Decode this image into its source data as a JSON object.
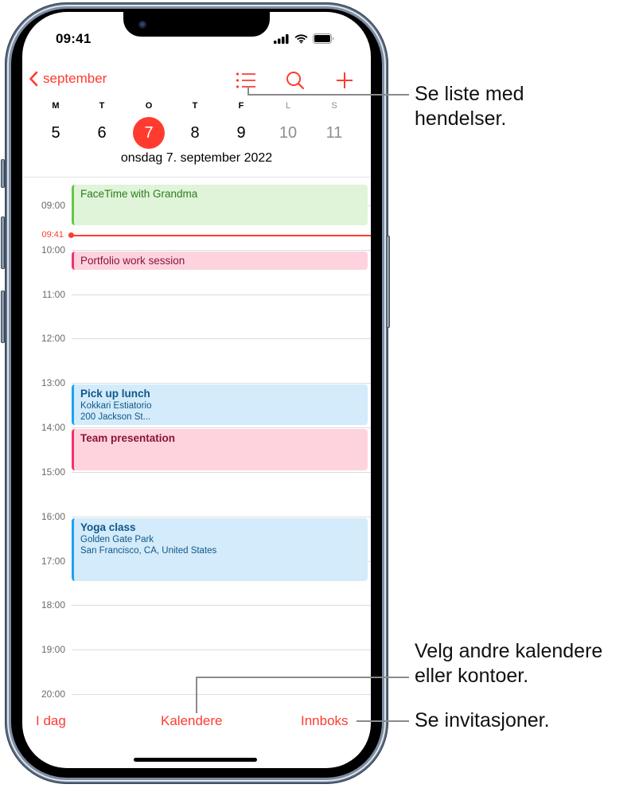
{
  "status_bar": {
    "time": "09:41",
    "icons": [
      "cellular-signal-icon",
      "wifi-icon",
      "battery-icon"
    ]
  },
  "nav": {
    "back_label": "september",
    "back_icon": "chevron-left-icon",
    "actions": [
      {
        "name": "list-view-button",
        "icon": "list-icon"
      },
      {
        "name": "search-button",
        "icon": "search-icon"
      },
      {
        "name": "add-event-button",
        "icon": "plus-icon"
      }
    ]
  },
  "week": {
    "days": [
      {
        "letter": "M",
        "number": "5",
        "selected": false,
        "weekend": false
      },
      {
        "letter": "T",
        "number": "6",
        "selected": false,
        "weekend": false
      },
      {
        "letter": "O",
        "number": "7",
        "selected": true,
        "weekend": false
      },
      {
        "letter": "T",
        "number": "8",
        "selected": false,
        "weekend": false
      },
      {
        "letter": "F",
        "number": "9",
        "selected": false,
        "weekend": false
      },
      {
        "letter": "L",
        "number": "10",
        "selected": false,
        "weekend": true
      },
      {
        "letter": "S",
        "number": "11",
        "selected": false,
        "weekend": true
      }
    ],
    "date_title": "onsdag 7. september 2022"
  },
  "timeline": {
    "hours": [
      "09:00",
      "10:00",
      "11:00",
      "12:00",
      "13:00",
      "14:00",
      "15:00",
      "16:00",
      "17:00",
      "18:00",
      "19:00",
      "20:00"
    ],
    "now_label": "09:41",
    "events": [
      {
        "title": "FaceTime with Grandma",
        "lines": [],
        "color": "green",
        "bold": false
      },
      {
        "title": "Portfolio work session",
        "lines": [],
        "color": "pink",
        "bold": false
      },
      {
        "title": "Pick up lunch",
        "lines": [
          "Kokkari Estiatorio",
          "200 Jackson St..."
        ],
        "color": "blue",
        "bold": true
      },
      {
        "title": "Team presentation",
        "lines": [],
        "color": "pink",
        "bold": true
      },
      {
        "title": "Yoga class",
        "lines": [
          "Golden Gate Park",
          "San Francisco, CA, United States"
        ],
        "color": "blue",
        "bold": true
      }
    ]
  },
  "toolbar": {
    "today_label": "I dag",
    "calendars_label": "Kalendere",
    "inbox_label": "Innboks"
  },
  "callouts": {
    "list": [
      "Se liste med",
      "hendelser."
    ],
    "calendars": [
      "Velg andre kalendere",
      "eller kontoer."
    ],
    "inbox": [
      "Se invitasjoner."
    ]
  },
  "colors": {
    "accent": "#ff3b30",
    "event_green": "#dff4d8",
    "event_pink": "#fed3de",
    "event_blue": "#d3ebfa"
  }
}
